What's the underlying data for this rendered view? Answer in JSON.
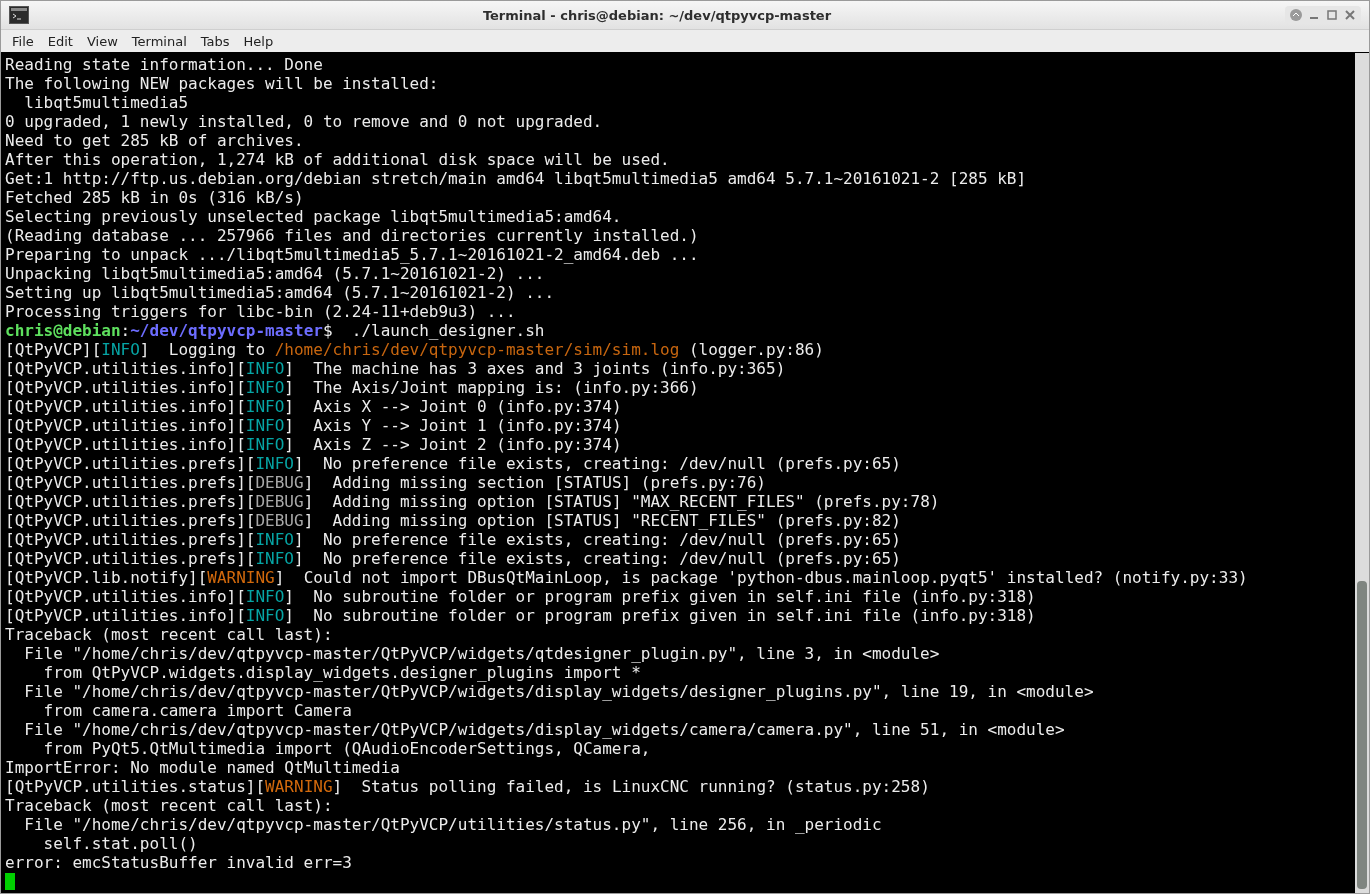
{
  "window": {
    "title": "Terminal - chris@debian: ~/dev/qtpyvcp-master"
  },
  "menu": [
    "File",
    "Edit",
    "View",
    "Terminal",
    "Tabs",
    "Help"
  ],
  "terminal": {
    "lines": [
      {
        "segments": [
          {
            "kind": "plain",
            "text": "Reading state information... Done"
          }
        ]
      },
      {
        "segments": [
          {
            "kind": "plain",
            "text": "The following NEW packages will be installed:"
          }
        ]
      },
      {
        "segments": [
          {
            "kind": "plain",
            "text": "  libqt5multimedia5"
          }
        ]
      },
      {
        "segments": [
          {
            "kind": "plain",
            "text": "0 upgraded, 1 newly installed, 0 to remove and 0 not upgraded."
          }
        ]
      },
      {
        "segments": [
          {
            "kind": "plain",
            "text": "Need to get 285 kB of archives."
          }
        ]
      },
      {
        "segments": [
          {
            "kind": "plain",
            "text": "After this operation, 1,274 kB of additional disk space will be used."
          }
        ]
      },
      {
        "segments": [
          {
            "kind": "plain",
            "text": "Get:1 http://ftp.us.debian.org/debian stretch/main amd64 libqt5multimedia5 amd64 5.7.1~20161021-2 [285 kB]"
          }
        ]
      },
      {
        "segments": [
          {
            "kind": "plain",
            "text": "Fetched 285 kB in 0s (316 kB/s)"
          }
        ]
      },
      {
        "segments": [
          {
            "kind": "plain",
            "text": "Selecting previously unselected package libqt5multimedia5:amd64."
          }
        ]
      },
      {
        "segments": [
          {
            "kind": "plain",
            "text": "(Reading database ... 257966 files and directories currently installed.)"
          }
        ]
      },
      {
        "segments": [
          {
            "kind": "plain",
            "text": "Preparing to unpack .../libqt5multimedia5_5.7.1~20161021-2_amd64.deb ..."
          }
        ]
      },
      {
        "segments": [
          {
            "kind": "plain",
            "text": "Unpacking libqt5multimedia5:amd64 (5.7.1~20161021-2) ..."
          }
        ]
      },
      {
        "segments": [
          {
            "kind": "plain",
            "text": "Setting up libqt5multimedia5:amd64 (5.7.1~20161021-2) ..."
          }
        ]
      },
      {
        "segments": [
          {
            "kind": "plain",
            "text": "Processing triggers for libc-bin (2.24-11+deb9u3) ..."
          }
        ]
      },
      {
        "segments": [
          {
            "kind": "user",
            "text": "chris@debian"
          },
          {
            "kind": "plain",
            "text": ":"
          },
          {
            "kind": "cwd",
            "text": "~/dev/qtpyvcp-master"
          },
          {
            "kind": "plain",
            "text": "$  ./launch_designer.sh"
          }
        ]
      },
      {
        "segments": [
          {
            "kind": "plain",
            "text": "[QtPyVCP]["
          },
          {
            "kind": "info",
            "text": "INFO"
          },
          {
            "kind": "plain",
            "text": "]  Logging to "
          },
          {
            "kind": "file",
            "text": "/home/chris/dev/qtpyvcp-master/sim/sim.log"
          },
          {
            "kind": "plain",
            "text": " (logger.py:86)"
          }
        ]
      },
      {
        "segments": [
          {
            "kind": "plain",
            "text": "[QtPyVCP.utilities.info]["
          },
          {
            "kind": "info",
            "text": "INFO"
          },
          {
            "kind": "plain",
            "text": "]  The machine has 3 axes and 3 joints (info.py:365)"
          }
        ]
      },
      {
        "segments": [
          {
            "kind": "plain",
            "text": "[QtPyVCP.utilities.info]["
          },
          {
            "kind": "info",
            "text": "INFO"
          },
          {
            "kind": "plain",
            "text": "]  The Axis/Joint mapping is: (info.py:366)"
          }
        ]
      },
      {
        "segments": [
          {
            "kind": "plain",
            "text": "[QtPyVCP.utilities.info]["
          },
          {
            "kind": "info",
            "text": "INFO"
          },
          {
            "kind": "plain",
            "text": "]  Axis X --> Joint 0 (info.py:374)"
          }
        ]
      },
      {
        "segments": [
          {
            "kind": "plain",
            "text": "[QtPyVCP.utilities.info]["
          },
          {
            "kind": "info",
            "text": "INFO"
          },
          {
            "kind": "plain",
            "text": "]  Axis Y --> Joint 1 (info.py:374)"
          }
        ]
      },
      {
        "segments": [
          {
            "kind": "plain",
            "text": "[QtPyVCP.utilities.info]["
          },
          {
            "kind": "info",
            "text": "INFO"
          },
          {
            "kind": "plain",
            "text": "]  Axis Z --> Joint 2 (info.py:374)"
          }
        ]
      },
      {
        "segments": [
          {
            "kind": "plain",
            "text": "[QtPyVCP.utilities.prefs]["
          },
          {
            "kind": "info",
            "text": "INFO"
          },
          {
            "kind": "plain",
            "text": "]  No preference file exists, creating: /dev/null (prefs.py:65)"
          }
        ]
      },
      {
        "segments": [
          {
            "kind": "plain",
            "text": "[QtPyVCP.utilities.prefs]["
          },
          {
            "kind": "debug",
            "text": "DEBUG"
          },
          {
            "kind": "plain",
            "text": "]  Adding missing section [STATUS] (prefs.py:76)"
          }
        ]
      },
      {
        "segments": [
          {
            "kind": "plain",
            "text": "[QtPyVCP.utilities.prefs]["
          },
          {
            "kind": "debug",
            "text": "DEBUG"
          },
          {
            "kind": "plain",
            "text": "]  Adding missing option [STATUS] \"MAX_RECENT_FILES\" (prefs.py:78)"
          }
        ]
      },
      {
        "segments": [
          {
            "kind": "plain",
            "text": "[QtPyVCP.utilities.prefs]["
          },
          {
            "kind": "debug",
            "text": "DEBUG"
          },
          {
            "kind": "plain",
            "text": "]  Adding missing option [STATUS] \"RECENT_FILES\" (prefs.py:82)"
          }
        ]
      },
      {
        "segments": [
          {
            "kind": "plain",
            "text": "[QtPyVCP.utilities.prefs]["
          },
          {
            "kind": "info",
            "text": "INFO"
          },
          {
            "kind": "plain",
            "text": "]  No preference file exists, creating: /dev/null (prefs.py:65)"
          }
        ]
      },
      {
        "segments": [
          {
            "kind": "plain",
            "text": "[QtPyVCP.utilities.prefs]["
          },
          {
            "kind": "info",
            "text": "INFO"
          },
          {
            "kind": "plain",
            "text": "]  No preference file exists, creating: /dev/null (prefs.py:65)"
          }
        ]
      },
      {
        "segments": [
          {
            "kind": "plain",
            "text": "[QtPyVCP.lib.notify]["
          },
          {
            "kind": "warning",
            "text": "WARNING"
          },
          {
            "kind": "plain",
            "text": "]  Could not import DBusQtMainLoop, is package 'python-dbus.mainloop.pyqt5' installed? (notify.py:33)"
          }
        ]
      },
      {
        "segments": [
          {
            "kind": "plain",
            "text": "[QtPyVCP.utilities.info]["
          },
          {
            "kind": "info",
            "text": "INFO"
          },
          {
            "kind": "plain",
            "text": "]  No subroutine folder or program prefix given in self.ini file (info.py:318)"
          }
        ]
      },
      {
        "segments": [
          {
            "kind": "plain",
            "text": "[QtPyVCP.utilities.info]["
          },
          {
            "kind": "info",
            "text": "INFO"
          },
          {
            "kind": "plain",
            "text": "]  No subroutine folder or program prefix given in self.ini file (info.py:318)"
          }
        ]
      },
      {
        "segments": [
          {
            "kind": "plain",
            "text": "Traceback (most recent call last):"
          }
        ]
      },
      {
        "segments": [
          {
            "kind": "plain",
            "text": "  File \"/home/chris/dev/qtpyvcp-master/QtPyVCP/widgets/qtdesigner_plugin.py\", line 3, in <module>"
          }
        ]
      },
      {
        "segments": [
          {
            "kind": "plain",
            "text": "    from QtPyVCP.widgets.display_widgets.designer_plugins import *"
          }
        ]
      },
      {
        "segments": [
          {
            "kind": "plain",
            "text": "  File \"/home/chris/dev/qtpyvcp-master/QtPyVCP/widgets/display_widgets/designer_plugins.py\", line 19, in <module>"
          }
        ]
      },
      {
        "segments": [
          {
            "kind": "plain",
            "text": "    from camera.camera import Camera"
          }
        ]
      },
      {
        "segments": [
          {
            "kind": "plain",
            "text": "  File \"/home/chris/dev/qtpyvcp-master/QtPyVCP/widgets/display_widgets/camera/camera.py\", line 51, in <module>"
          }
        ]
      },
      {
        "segments": [
          {
            "kind": "plain",
            "text": "    from PyQt5.QtMultimedia import (QAudioEncoderSettings, QCamera,"
          }
        ]
      },
      {
        "segments": [
          {
            "kind": "plain",
            "text": "ImportError: No module named QtMultimedia"
          }
        ]
      },
      {
        "segments": [
          {
            "kind": "plain",
            "text": "[QtPyVCP.utilities.status]["
          },
          {
            "kind": "warning",
            "text": "WARNING"
          },
          {
            "kind": "plain",
            "text": "]  Status polling failed, is LinuxCNC running? (status.py:258)"
          }
        ]
      },
      {
        "segments": [
          {
            "kind": "plain",
            "text": "Traceback (most recent call last):"
          }
        ]
      },
      {
        "segments": [
          {
            "kind": "plain",
            "text": "  File \"/home/chris/dev/qtpyvcp-master/QtPyVCP/utilities/status.py\", line 256, in _periodic"
          }
        ]
      },
      {
        "segments": [
          {
            "kind": "plain",
            "text": "    self.stat.poll()"
          }
        ]
      },
      {
        "segments": [
          {
            "kind": "plain",
            "text": "error: emcStatusBuffer invalid err=3"
          }
        ]
      }
    ]
  }
}
